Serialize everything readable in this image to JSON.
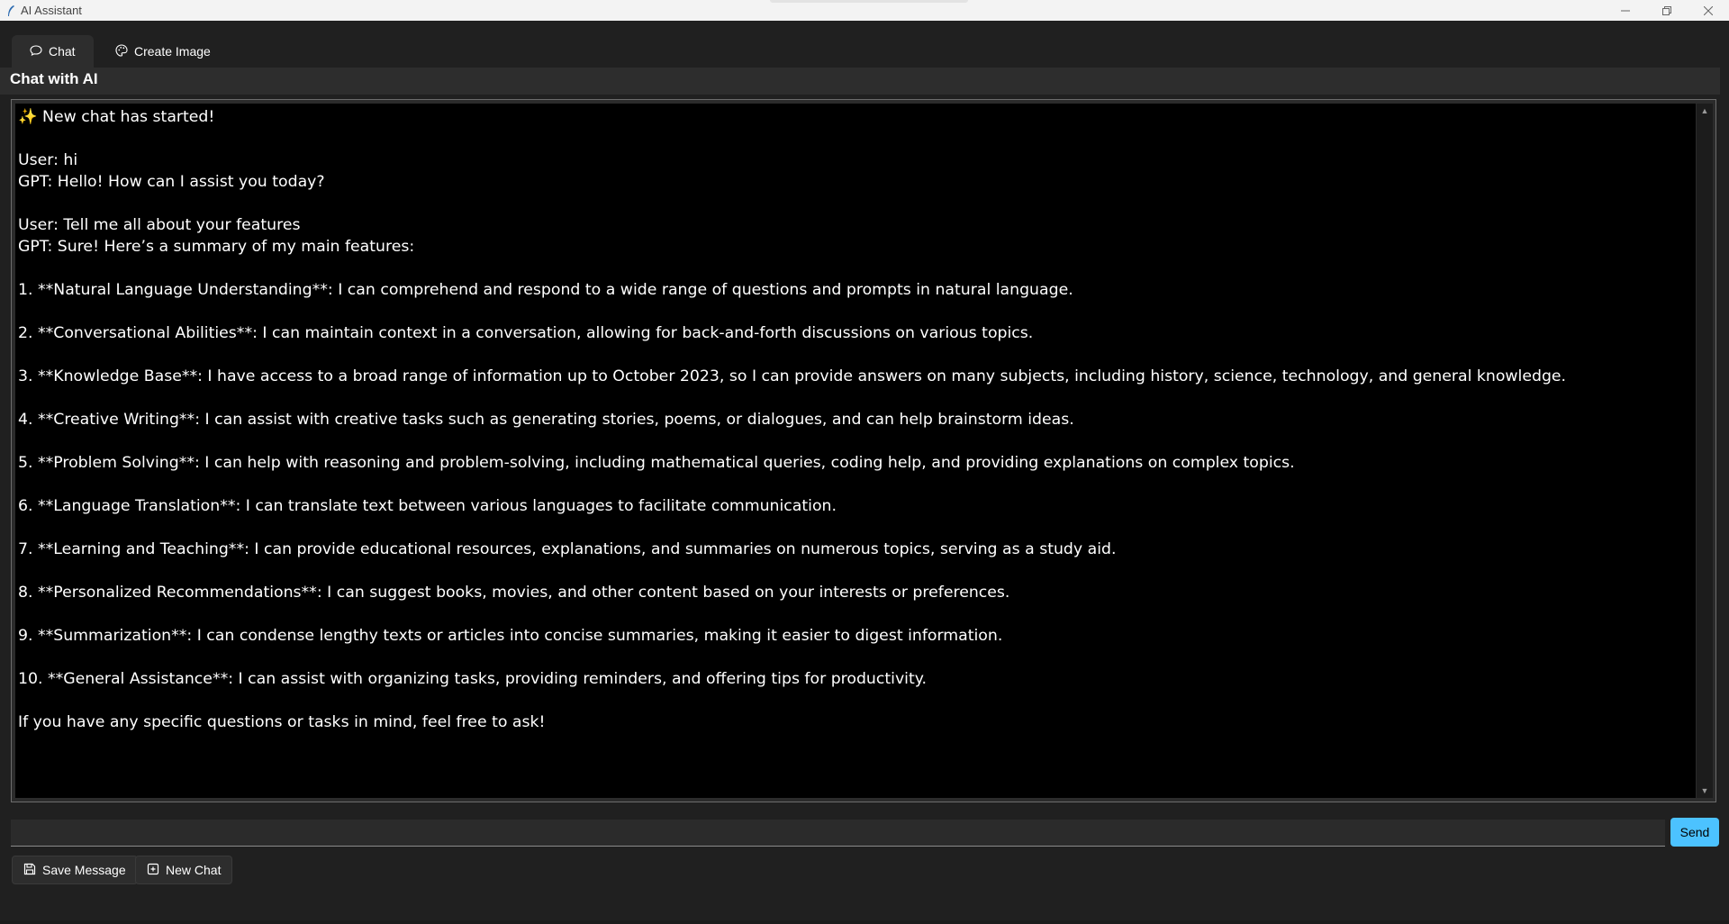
{
  "window": {
    "title": "AI Assistant",
    "controls": [
      "minimize-icon",
      "maximize-icon",
      "close-icon"
    ]
  },
  "tabs": [
    {
      "label": "Chat",
      "icon": "chat-bubble-icon",
      "active": true
    },
    {
      "label": "Create Image",
      "icon": "palette-icon",
      "active": false
    }
  ],
  "heading": "Chat with AI",
  "chat": {
    "lines": [
      "✨ New chat has started!",
      "",
      "User: hi",
      "GPT: Hello! How can I assist you today?",
      "",
      "User: Tell me all about your features",
      "GPT: Sure! Here’s a summary of my main features:",
      "",
      "1. **Natural Language Understanding**: I can comprehend and respond to a wide range of questions and prompts in natural language.",
      "",
      "2. **Conversational Abilities**: I can maintain context in a conversation, allowing for back-and-forth discussions on various topics.",
      "",
      "3. **Knowledge Base**: I have access to a broad range of information up to October 2023, so I can provide answers on many subjects, including history, science, technology, and general knowledge.",
      "",
      "4. **Creative Writing**: I can assist with creative tasks such as generating stories, poems, or dialogues, and can help brainstorm ideas.",
      "",
      "5. **Problem Solving**: I can help with reasoning and problem-solving, including mathematical queries, coding help, and providing explanations on complex topics.",
      "",
      "6. **Language Translation**: I can translate text between various languages to facilitate communication.",
      "",
      "7. **Learning and Teaching**: I can provide educational resources, explanations, and summaries on numerous topics, serving as a study aid.",
      "",
      "8. **Personalized Recommendations**: I can suggest books, movies, and other content based on your interests or preferences.",
      "",
      "9. **Summarization**: I can condense lengthy texts or articles into concise summaries, making it easier to digest information.",
      "",
      "10. **General Assistance**: I can assist with organizing tasks, providing reminders, and offering tips for productivity.",
      "",
      "If you have any specific questions or tasks in mind, feel free to ask!"
    ]
  },
  "input": {
    "value": "",
    "placeholder": ""
  },
  "buttons": {
    "send": "Send",
    "save": "Save Message",
    "new_chat": "New Chat"
  },
  "colors": {
    "accent": "#4cc2ff",
    "chat_background": "#000000",
    "window_background": "#202020"
  }
}
